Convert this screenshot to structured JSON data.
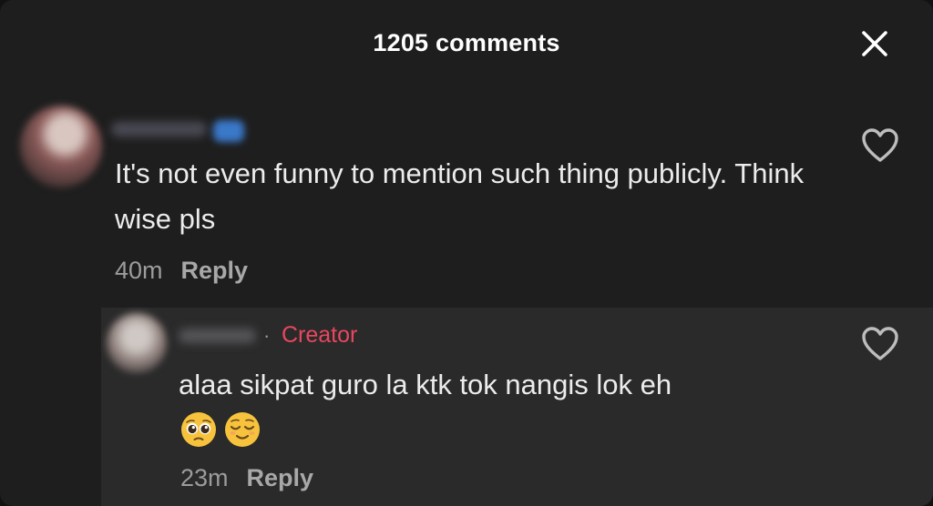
{
  "header": {
    "title": "1205 comments",
    "close_icon": "close-icon"
  },
  "comments": [
    {
      "text": "It's not even funny to mention such thing publicly. Think wise pls",
      "time": "40m",
      "reply_label": "Reply",
      "like_icon": "heart-outline-icon"
    }
  ],
  "replies": [
    {
      "badge": "Creator",
      "separator": "·",
      "text": "alaa sikpat guro la ktk tok nangis lok eh",
      "emojis": [
        "pleading-face",
        "relieved-face"
      ],
      "time": "23m",
      "reply_label": "Reply",
      "like_icon": "heart-outline-icon"
    }
  ],
  "colors": {
    "background": "#1e1e1e",
    "reply_background": "#2a2a2a",
    "creator_badge": "#e8475f",
    "secondary_text": "#9c9c9c"
  }
}
